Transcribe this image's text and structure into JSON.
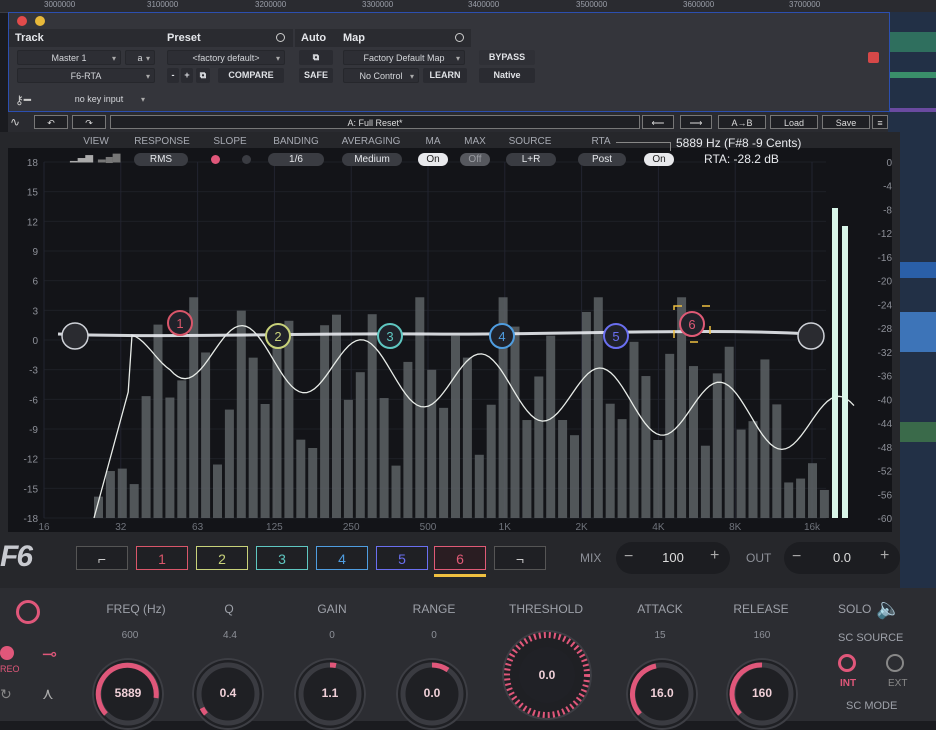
{
  "ruler": {
    "ticks": [
      "3000000",
      "3100000",
      "3200000",
      "3300000",
      "3400000",
      "3500000",
      "3600000",
      "3700000"
    ]
  },
  "host": {
    "track_header": "Track",
    "preset_header": "Preset",
    "auto_header": "Auto",
    "map_header": "Map",
    "track_name": "Master 1",
    "track_slot": "a",
    "plugin_name": "F6-RTA",
    "preset_value": "<factory default>",
    "compare_label": "COMPARE",
    "safe_label": "SAFE",
    "map_value": "Factory Default Map",
    "map_control": "No Control",
    "learn_label": "LEARN",
    "bypass_label": "BYPASS",
    "native_label": "Native",
    "key_input": "no key input",
    "minus": "-",
    "plus": "+"
  },
  "toolbar": {
    "preset_name": "A: Full Reset*",
    "ab_label": "A→B",
    "load_label": "Load",
    "save_label": "Save"
  },
  "controls": {
    "view_label": "VIEW",
    "response_label": "RESPONSE",
    "response_value": "RMS",
    "slope_label": "SLOPE",
    "banding_label": "BANDING",
    "banding_value": "1/6",
    "averaging_label": "AVERAGING",
    "averaging_value": "Medium",
    "ma_label": "MA",
    "ma_value": "On",
    "max_label": "MAX",
    "max_value": "Off",
    "source_label": "SOURCE",
    "source_value": "L+R",
    "rta_label": "RTA",
    "rta_value": "Post",
    "rta_toggle": "On",
    "readout_freq": "5889 Hz (F#8 -9 Cents)",
    "readout_rta": "RTA: -28.2 dB"
  },
  "graph": {
    "left_axis": [
      "18",
      "15",
      "12",
      "9",
      "6",
      "3",
      "0",
      "-3",
      "-6",
      "-9",
      "-12",
      "-15",
      "-18"
    ],
    "right_axis": [
      "0",
      "-4",
      "-8",
      "-12",
      "-16",
      "-20",
      "-24",
      "-28",
      "-32",
      "-36",
      "-40",
      "-44",
      "-48",
      "-52",
      "-56",
      "-60"
    ],
    "freq_axis": [
      "16",
      "32",
      "63",
      "125",
      "250",
      "500",
      "1K",
      "2K",
      "4K",
      "8K",
      "16k"
    ],
    "bands": [
      {
        "id": "1",
        "color": "#d9566a"
      },
      {
        "id": "2",
        "color": "#c8d27a"
      },
      {
        "id": "3",
        "color": "#5fc7c1"
      },
      {
        "id": "4",
        "color": "#4f9de0"
      },
      {
        "id": "5",
        "color": "#6a6ff0"
      },
      {
        "id": "6",
        "color": "#e05a76"
      }
    ]
  },
  "bandstrip": {
    "labels": [
      "1",
      "2",
      "3",
      "4",
      "5",
      "6"
    ],
    "mix_label": "MIX",
    "mix_value": "100",
    "out_label": "OUT",
    "out_value": "0.0",
    "minus": "−",
    "plus": "+"
  },
  "knobs": {
    "freq": {
      "label": "FREQ (Hz)",
      "default": "600",
      "value": "5889"
    },
    "q": {
      "label": "Q",
      "default": "4.4",
      "value": "0.4"
    },
    "gain": {
      "label": "GAIN",
      "default": "0",
      "value": "1.1"
    },
    "range": {
      "label": "RANGE",
      "default": "0",
      "value": "0.0"
    },
    "threshold": {
      "label": "THRESHOLD",
      "value": "0.0"
    },
    "attack": {
      "label": "ATTACK",
      "default": "15",
      "value": "16.0"
    },
    "release": {
      "label": "RELEASE",
      "default": "160",
      "value": "160"
    }
  },
  "side": {
    "solo_label": "SOLO",
    "sc_source_label": "SC SOURCE",
    "int_label": "INT",
    "ext_label": "EXT",
    "sc_mode_label": "SC MODE",
    "stereo_label": "REO",
    "logo": "F6"
  },
  "colors": {
    "accent": "#e0577a",
    "highlight": "#f0c040",
    "meter": "#d8f5e8"
  }
}
